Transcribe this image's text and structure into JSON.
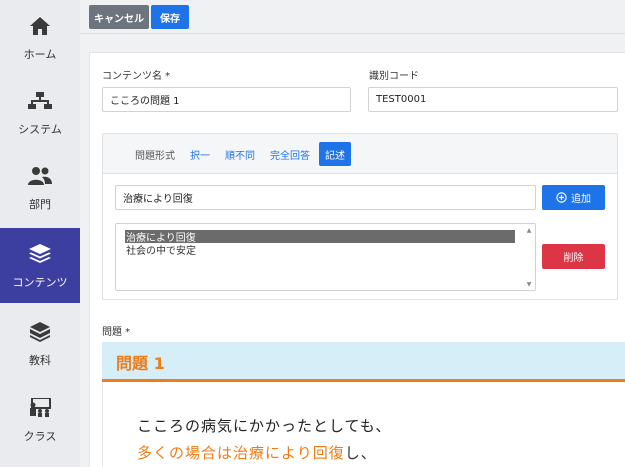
{
  "sidebar": {
    "items": [
      {
        "label": "ホーム",
        "icon": "home-icon"
      },
      {
        "label": "システム",
        "icon": "sitemap-icon"
      },
      {
        "label": "部門",
        "icon": "users-icon"
      },
      {
        "label": "コンテンツ",
        "icon": "layers-icon",
        "active": true
      },
      {
        "label": "教科",
        "icon": "books-icon"
      },
      {
        "label": "クラス",
        "icon": "classroom-icon"
      }
    ]
  },
  "toolbar": {
    "cancel_label": "キャンセル",
    "save_label": "保存"
  },
  "form": {
    "content_name_label": "コンテンツ名 *",
    "content_name_value": "こころの問題 1",
    "code_label": "識別コード",
    "code_value": "TEST0001",
    "tabs": {
      "title": "問題形式",
      "items": [
        "択一",
        "順不同",
        "完全回答",
        "記述"
      ],
      "active": "記述"
    },
    "answer_input_value": "治療により回復",
    "add_label": "追加",
    "delete_label": "削除",
    "answers": [
      "治療により回復",
      "社会の中で安定"
    ],
    "question_label": "問題 *"
  },
  "preview": {
    "title": "問題 1",
    "line1": "こころの病気にかかったとしても、",
    "line2_highlight": "多くの場合は治療により回復",
    "line2_rest": "し、"
  },
  "colors": {
    "accent": "#1e73e8",
    "sidebar_active": "#3d3fa0",
    "danger": "#dc3545",
    "orange": "#ef7d17"
  }
}
